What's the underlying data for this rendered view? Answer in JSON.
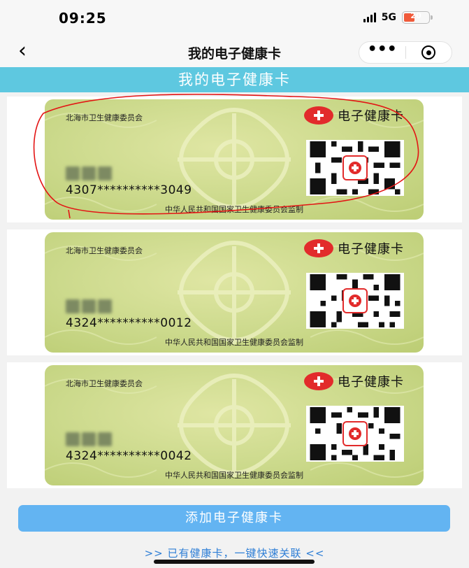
{
  "status_bar": {
    "time": "09:25",
    "network": "5G",
    "battery": "20"
  },
  "nav": {
    "title": "我的电子健康卡"
  },
  "header": {
    "banner": "我的电子健康卡"
  },
  "cards": [
    {
      "issuer": "北海市卫生健康委员会",
      "brand": "电子健康卡",
      "number": "4307**********3049",
      "supervisor": "中华人民共和国国家卫生健康委员会监制"
    },
    {
      "issuer": "北海市卫生健康委员会",
      "brand": "电子健康卡",
      "number": "4324**********0012",
      "supervisor": "中华人民共和国国家卫生健康委员会监制"
    },
    {
      "issuer": "北海市卫生健康委员会",
      "brand": "电子健康卡",
      "number": "4324**********0042",
      "supervisor": "中华人民共和国国家卫生健康委员会监制"
    }
  ],
  "actions": {
    "add_card": "添加电子健康卡",
    "link_existing": ">> 已有健康卡，一键快速关联 <<"
  },
  "colors": {
    "banner": "#5ec8e0",
    "button": "#63b4f2",
    "card": "#cbd98b",
    "brand_red": "#e22b2b",
    "link": "#2f7fd6"
  },
  "icons": [
    "back-icon",
    "more-icon",
    "target-icon",
    "signal-icon",
    "battery-icon",
    "cross-badge-icon",
    "qr-code"
  ]
}
